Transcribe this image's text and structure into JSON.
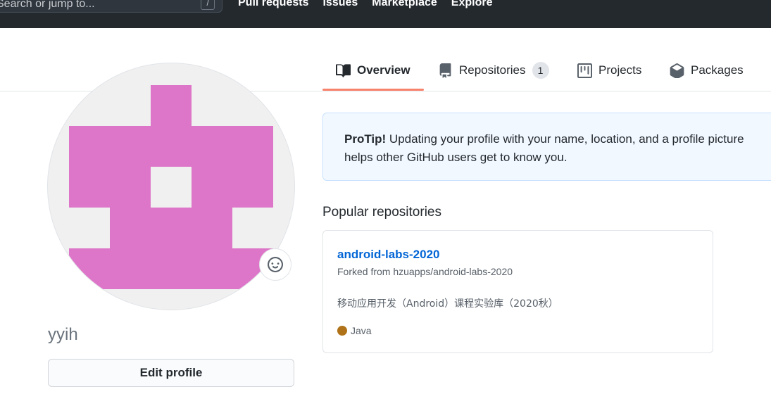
{
  "header": {
    "search_placeholder": "Search or jump to...",
    "search_shortcut": "/",
    "nav": [
      "Pull requests",
      "Issues",
      "Marketplace",
      "Explore"
    ]
  },
  "tabs": {
    "overview": "Overview",
    "repositories": "Repositories",
    "repositories_count": "1",
    "projects": "Projects",
    "packages": "Packages"
  },
  "profile": {
    "username": "yyih",
    "edit_button": "Edit profile",
    "status_icon": "smiley-icon",
    "avatar_color": "#dd76c8"
  },
  "protip": {
    "label": "ProTip!",
    "text": " Updating your profile with your name, location, and a profile picture helps other GitHub users get to know you."
  },
  "popular": {
    "title": "Popular repositories",
    "repos": [
      {
        "name": "android-labs-2020",
        "forked_from": "Forked from hzuapps/android-labs-2020",
        "description": "移动应用开发（Android）课程实验库（2020秋）",
        "language": "Java",
        "language_color": "#b07219"
      }
    ]
  },
  "colors": {
    "accent": "#0366d6",
    "tab_underline": "#f9826c",
    "header_bg": "#24292e"
  }
}
